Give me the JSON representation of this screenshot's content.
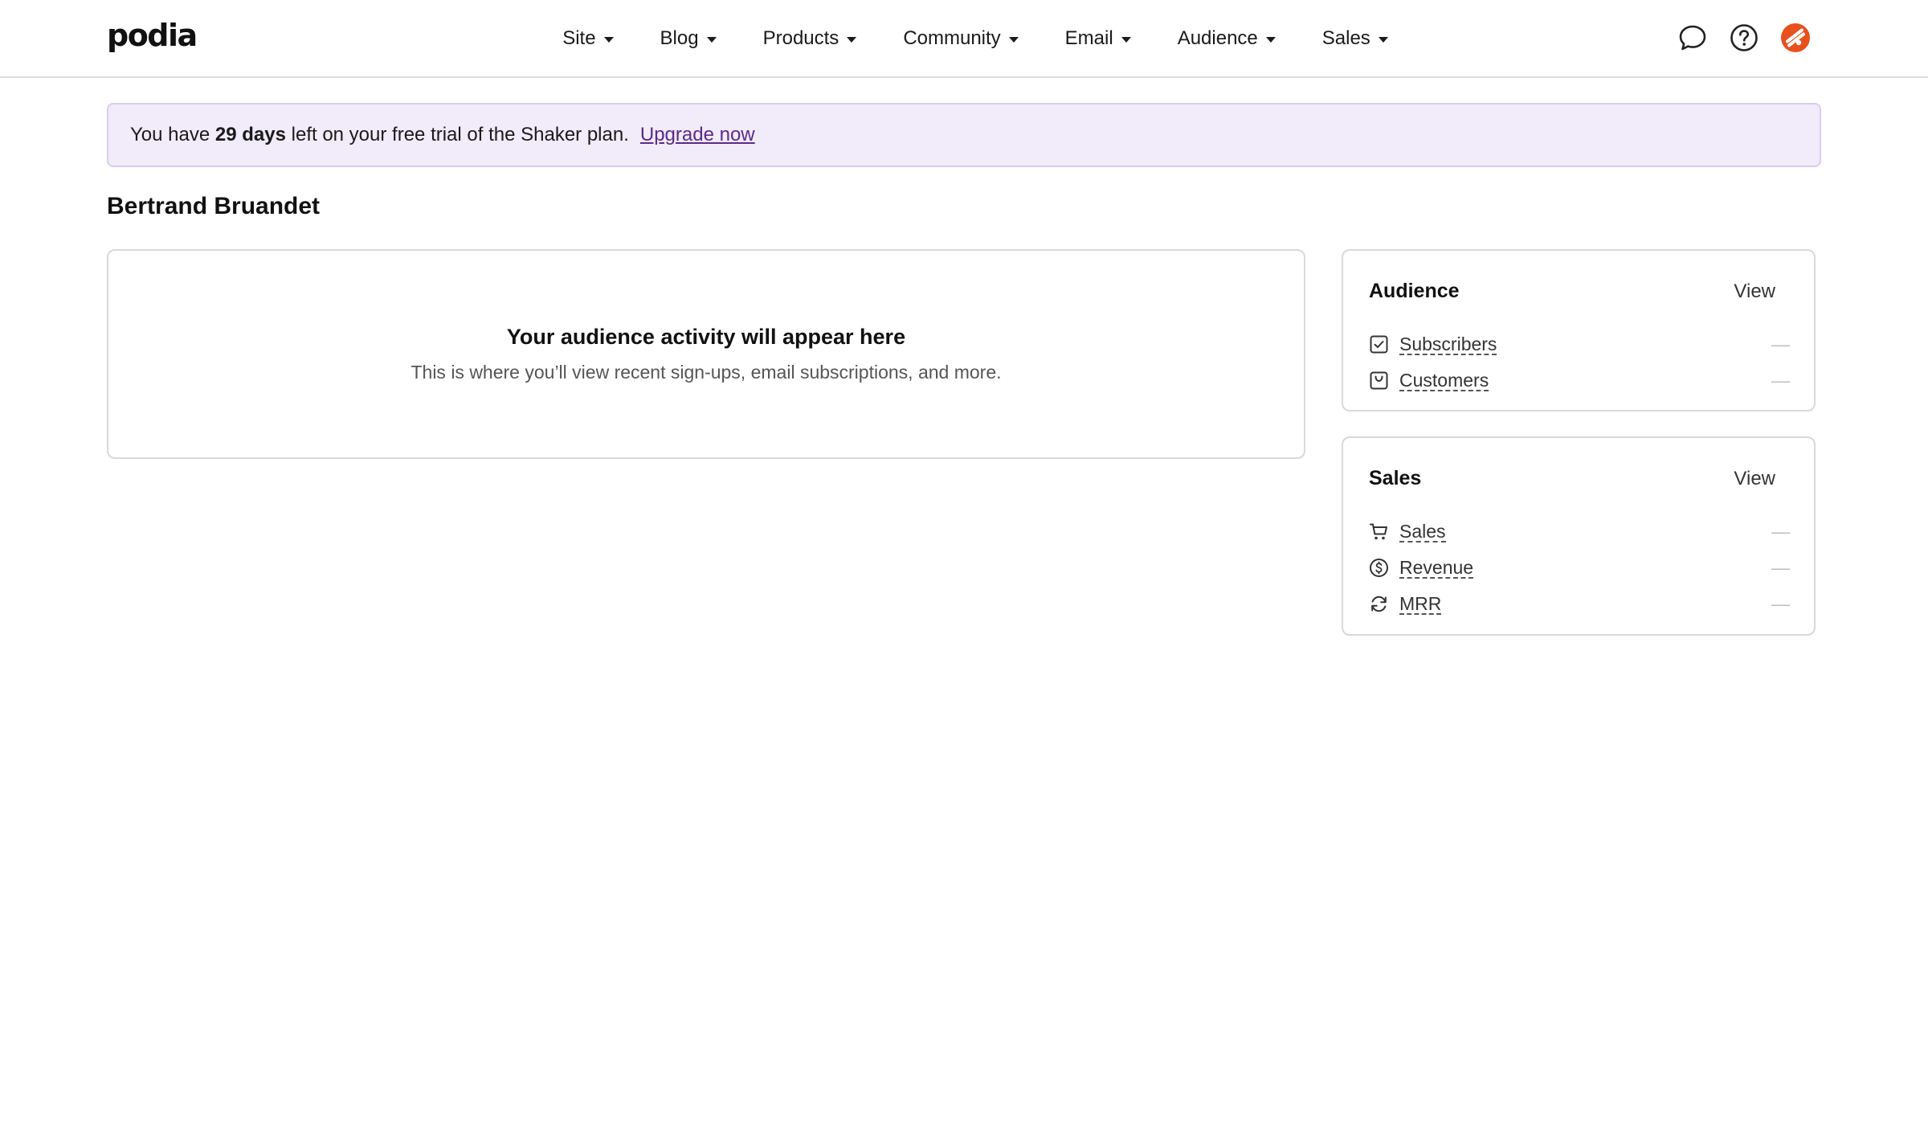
{
  "header": {
    "logo": "podia",
    "nav": [
      {
        "label": "Site"
      },
      {
        "label": "Blog"
      },
      {
        "label": "Products"
      },
      {
        "label": "Community"
      },
      {
        "label": "Email"
      },
      {
        "label": "Audience"
      },
      {
        "label": "Sales"
      }
    ],
    "icons": [
      "chat-bubble-icon",
      "help-circle-icon",
      "account-avatar-icon"
    ],
    "avatar_color": "#e8501d"
  },
  "banner": {
    "text_before": "You have ",
    "days": "29 days",
    "text_after": " left on your free trial of the Shaker plan.",
    "link": "Upgrade now",
    "background": "#f1ebfa",
    "link_color": "#5b2a8a"
  },
  "page": {
    "title": "Bertrand Bruandet"
  },
  "activity": {
    "heading": "Your audience activity will appear here",
    "subtext": "This is where you’ll view recent sign-ups, email subscriptions, and more."
  },
  "audience_card": {
    "title": "Audience",
    "view_label": "View",
    "rows": [
      {
        "icon": "checkbox-icon",
        "label": "Subscribers",
        "value": "—"
      },
      {
        "icon": "shopping-bag-icon",
        "label": "Customers",
        "value": "—"
      }
    ]
  },
  "sales_card": {
    "title": "Sales",
    "view_label": "View",
    "rows": [
      {
        "icon": "cart-icon",
        "label": "Sales",
        "value": "—"
      },
      {
        "icon": "dollar-circle-icon",
        "label": "Revenue",
        "value": "—"
      },
      {
        "icon": "refresh-icon",
        "label": "MRR",
        "value": "—"
      }
    ]
  }
}
